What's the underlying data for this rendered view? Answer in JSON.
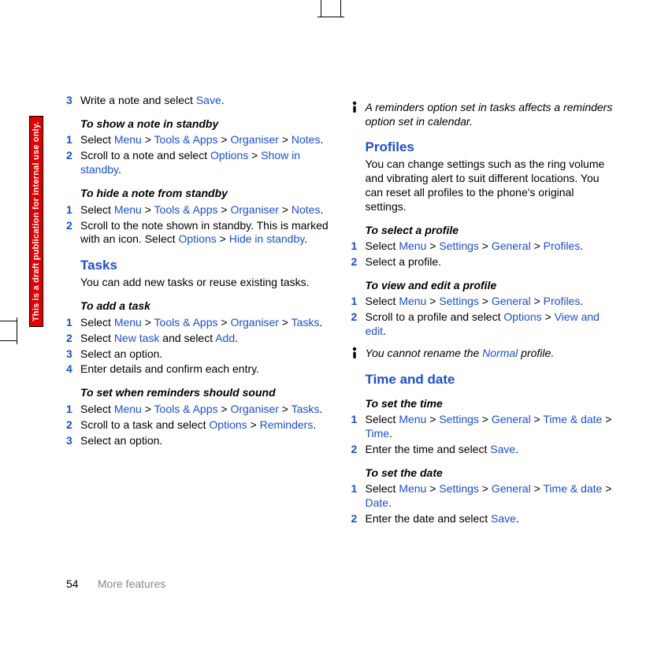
{
  "watermark": "This is a draft publication for internal use only.",
  "footer": {
    "page": "54",
    "section": "More features"
  },
  "left": {
    "orphanStep": {
      "num": "3",
      "t1": "Write a note and select ",
      "l1": "Save",
      "t2": "."
    },
    "showNote": {
      "title": "To show a note in standby",
      "steps": [
        {
          "n": "1",
          "p0": "Select ",
          "l0": "Menu",
          "p1": " > ",
          "l1": "Tools & Apps",
          "p2": " > ",
          "l2": "Organiser",
          "p3": " > ",
          "l3": "Notes",
          "p4": "."
        },
        {
          "n": "2",
          "p0": "Scroll to a note and select ",
          "l0": "Options",
          "p1": " > ",
          "l1": "Show in standby",
          "p2": "."
        }
      ]
    },
    "hideNote": {
      "title": "To hide a note from standby",
      "steps": [
        {
          "n": "1",
          "p0": "Select ",
          "l0": "Menu",
          "p1": " > ",
          "l1": "Tools & Apps",
          "p2": " > ",
          "l2": "Organiser",
          "p3": " > ",
          "l3": "Notes",
          "p4": "."
        },
        {
          "n": "2",
          "p0": "Scroll to the note shown in standby. This is marked with an icon. Select ",
          "l0": "Options",
          "p1": " > ",
          "l1": "Hide in standby",
          "p2": "."
        }
      ]
    },
    "tasks": {
      "title": "Tasks",
      "body": "You can add new tasks or reuse existing tasks."
    },
    "addTask": {
      "title": "To add a task",
      "steps": [
        {
          "n": "1",
          "p0": "Select ",
          "l0": "Menu",
          "p1": " > ",
          "l1": "Tools & Apps",
          "p2": " > ",
          "l2": "Organiser",
          "p3": " > ",
          "l3": "Tasks",
          "p4": "."
        },
        {
          "n": "2",
          "p0": "Select ",
          "l0": "New task",
          "p1": " and select ",
          "l1": "Add",
          "p2": "."
        },
        {
          "n": "3",
          "p0": "Select an option."
        },
        {
          "n": "4",
          "p0": "Enter details and confirm each entry."
        }
      ]
    },
    "reminders": {
      "title": "To set when reminders should sound",
      "steps": [
        {
          "n": "1",
          "p0": "Select ",
          "l0": "Menu",
          "p1": " > ",
          "l1": "Tools & Apps",
          "p2": " > ",
          "l2": "Organiser",
          "p3": " > ",
          "l3": "Tasks",
          "p4": "."
        },
        {
          "n": "2",
          "p0": "Scroll to a task and select ",
          "l0": "Options",
          "p1": " > ",
          "l1": "Reminders",
          "p2": "."
        },
        {
          "n": "3",
          "p0": "Select an option."
        }
      ]
    }
  },
  "right": {
    "note1": "A reminders option set in tasks affects a reminders option set in calendar.",
    "profiles": {
      "title": "Profiles",
      "body": "You can change settings such as the ring volume and vibrating alert to suit different locations. You can reset all profiles to the phone's original settings."
    },
    "selectProfile": {
      "title": "To select a profile",
      "steps": [
        {
          "n": "1",
          "p0": "Select ",
          "l0": "Menu",
          "p1": " > ",
          "l1": "Settings",
          "p2": " > ",
          "l2": "General",
          "p3": " > ",
          "l3": "Profiles",
          "p4": "."
        },
        {
          "n": "2",
          "p0": "Select a profile."
        }
      ]
    },
    "viewEditProfile": {
      "title": "To view and edit a profile",
      "steps": [
        {
          "n": "1",
          "p0": "Select ",
          "l0": "Menu",
          "p1": " > ",
          "l1": "Settings",
          "p2": " > ",
          "l2": "General",
          "p3": " > ",
          "l3": "Profiles",
          "p4": "."
        },
        {
          "n": "2",
          "p0": "Scroll to a profile and select ",
          "l0": "Options",
          "p1": " > ",
          "l1": "View and edit",
          "p2": "."
        }
      ]
    },
    "note2": {
      "p0": "You cannot rename the ",
      "l0": "Normal",
      "p1": " profile."
    },
    "timeDate": {
      "title": "Time and date"
    },
    "setTime": {
      "title": "To set the time",
      "steps": [
        {
          "n": "1",
          "p0": "Select ",
          "l0": "Menu",
          "p1": " > ",
          "l1": "Settings",
          "p2": " > ",
          "l2": "General",
          "p3": " > ",
          "l3": "Time & date",
          "p4": " > ",
          "l4": "Time",
          "p5": "."
        },
        {
          "n": "2",
          "p0": "Enter the time and select ",
          "l0": "Save",
          "p1": "."
        }
      ]
    },
    "setDate": {
      "title": "To set the date",
      "steps": [
        {
          "n": "1",
          "p0": "Select ",
          "l0": "Menu",
          "p1": " > ",
          "l1": "Settings",
          "p2": " > ",
          "l2": "General",
          "p3": " > ",
          "l3": "Time & date",
          "p4": " > ",
          "l4": "Date",
          "p5": "."
        },
        {
          "n": "2",
          "p0": "Enter the date and select ",
          "l0": "Save",
          "p1": "."
        }
      ]
    }
  }
}
